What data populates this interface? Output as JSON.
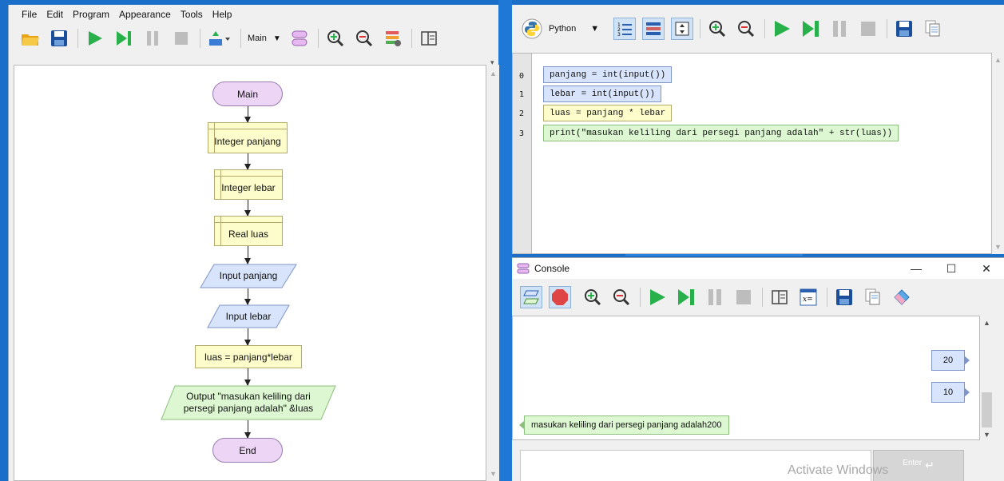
{
  "left_window": {
    "menu": [
      "File",
      "Edit",
      "Program",
      "Appearance",
      "Tools",
      "Help"
    ],
    "toolbar": {
      "function_select": "Main"
    },
    "flowchart": {
      "nodes": [
        {
          "id": "start",
          "type": "terminal",
          "text": "Main"
        },
        {
          "id": "decl-panjang",
          "type": "declare",
          "text": "Integer panjang"
        },
        {
          "id": "decl-lebar",
          "type": "declare",
          "text": "Integer lebar"
        },
        {
          "id": "decl-luas",
          "type": "declare",
          "text": "Real luas"
        },
        {
          "id": "input-panjang",
          "type": "input",
          "text": "Input panjang"
        },
        {
          "id": "input-lebar",
          "type": "input",
          "text": "Input lebar"
        },
        {
          "id": "assign-luas",
          "type": "assign",
          "text": "luas = panjang*lebar"
        },
        {
          "id": "output",
          "type": "output",
          "text_line1": "Output \"masukan keliling dari",
          "text_line2": "persegi panjang adalah\" &luas"
        },
        {
          "id": "end",
          "type": "terminal",
          "text": "End"
        }
      ]
    }
  },
  "code_window": {
    "language": "Python",
    "lines": [
      {
        "num": "0",
        "code": "panjang = int(input())",
        "kind": "input"
      },
      {
        "num": "1",
        "code": "lebar = int(input())",
        "kind": "input"
      },
      {
        "num": "2",
        "code": "luas = panjang * lebar",
        "kind": "assign"
      },
      {
        "num": "3",
        "code": "print(\"masukan keliling dari persegi panjang adalah\" + str(luas))",
        "kind": "output"
      }
    ]
  },
  "console": {
    "title": "Console",
    "controls": {
      "minimize": "—",
      "maximize": "☐",
      "close": "✕"
    },
    "inputs": [
      "20",
      "10"
    ],
    "output": "masukan keliling dari persegi panjang adalah200",
    "enter_label": "Enter"
  },
  "watermark": "Activate Windows",
  "colors": {
    "terminal_fill": "#ecd5f5",
    "declare_fill": "#fdfdcc",
    "input_fill": "#d8e4fb",
    "output_fill": "#dcf7d1",
    "desktop": "#1c6fc9"
  }
}
